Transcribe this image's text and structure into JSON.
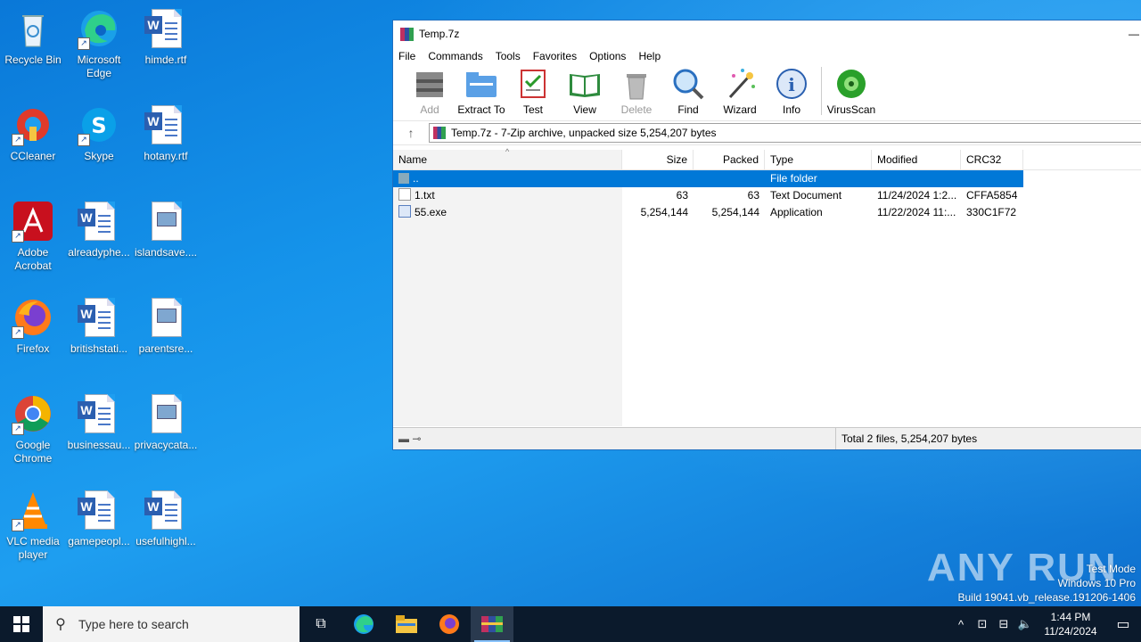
{
  "desktop": {
    "icons": [
      {
        "label": "Recycle Bin",
        "icon": "recycle-bin-icon"
      },
      {
        "label": "Microsoft Edge",
        "icon": "edge-icon"
      },
      {
        "label": "himde.rtf",
        "icon": "word-doc-icon"
      },
      {
        "label": "CCleaner",
        "icon": "ccleaner-icon"
      },
      {
        "label": "Skype",
        "icon": "skype-icon"
      },
      {
        "label": "hotany.rtf",
        "icon": "word-doc-icon"
      },
      {
        "label": "Adobe Acrobat",
        "icon": "acrobat-icon"
      },
      {
        "label": "alreadyphe...",
        "icon": "word-doc-icon"
      },
      {
        "label": "islandsave....",
        "icon": "image-file-icon"
      },
      {
        "label": "Firefox",
        "icon": "firefox-icon"
      },
      {
        "label": "britishstati...",
        "icon": "word-doc-icon"
      },
      {
        "label": "parentsre...",
        "icon": "image-file-icon"
      },
      {
        "label": "Google Chrome",
        "icon": "chrome-icon"
      },
      {
        "label": "businessau...",
        "icon": "word-doc-icon"
      },
      {
        "label": "privacycata...",
        "icon": "image-file-icon"
      },
      {
        "label": "VLC media player",
        "icon": "vlc-icon"
      },
      {
        "label": "gamepeopl...",
        "icon": "word-doc-icon"
      },
      {
        "label": "usefulhighl...",
        "icon": "word-doc-icon"
      }
    ]
  },
  "window": {
    "title": "Temp.7z",
    "menu": [
      "File",
      "Commands",
      "Tools",
      "Favorites",
      "Options",
      "Help"
    ],
    "toolbar": [
      {
        "label": "Add",
        "icon": "add-archive-icon",
        "disabled": true
      },
      {
        "label": "Extract To",
        "icon": "extract-to-icon",
        "disabled": false
      },
      {
        "label": "Test",
        "icon": "test-icon",
        "disabled": false
      },
      {
        "label": "View",
        "icon": "view-book-icon",
        "disabled": false
      },
      {
        "label": "Delete",
        "icon": "trash-icon",
        "disabled": true
      },
      {
        "label": "Find",
        "icon": "magnifier-icon",
        "disabled": false
      },
      {
        "label": "Wizard",
        "icon": "wizard-wand-icon",
        "disabled": false
      },
      {
        "label": "Info",
        "icon": "info-icon",
        "disabled": false
      },
      {
        "label": "VirusScan",
        "icon": "virus-scan-icon",
        "disabled": false
      }
    ],
    "address": "Temp.7z - 7-Zip archive, unpacked size 5,254,207 bytes",
    "columns": {
      "name": "Name",
      "size": "Size",
      "packed": "Packed",
      "type": "Type",
      "modified": "Modified",
      "crc": "CRC32"
    },
    "rows": [
      {
        "name": "..",
        "size": "",
        "packed": "",
        "type": "File folder",
        "modified": "",
        "crc": "",
        "selected": true,
        "kind": "folder"
      },
      {
        "name": "1.txt",
        "size": "63",
        "packed": "63",
        "type": "Text Document",
        "modified": "11/24/2024 1:2...",
        "crc": "CFFA5854",
        "selected": false,
        "kind": "text"
      },
      {
        "name": "55.exe",
        "size": "5,254,144",
        "packed": "5,254,144",
        "type": "Application",
        "modified": "11/22/2024 11:...",
        "crc": "330C1F72",
        "selected": false,
        "kind": "exe"
      }
    ],
    "status": "Total 2 files, 5,254,207 bytes"
  },
  "taskbar": {
    "search_placeholder": "Type here to search",
    "time": "1:44 PM",
    "date": "11/24/2024"
  },
  "watermark": {
    "brand": "ANY RUN",
    "line1": "Test Mode",
    "line2": "Windows 10 Pro",
    "line3": "Build 19041.vb_release.191206-1406"
  }
}
